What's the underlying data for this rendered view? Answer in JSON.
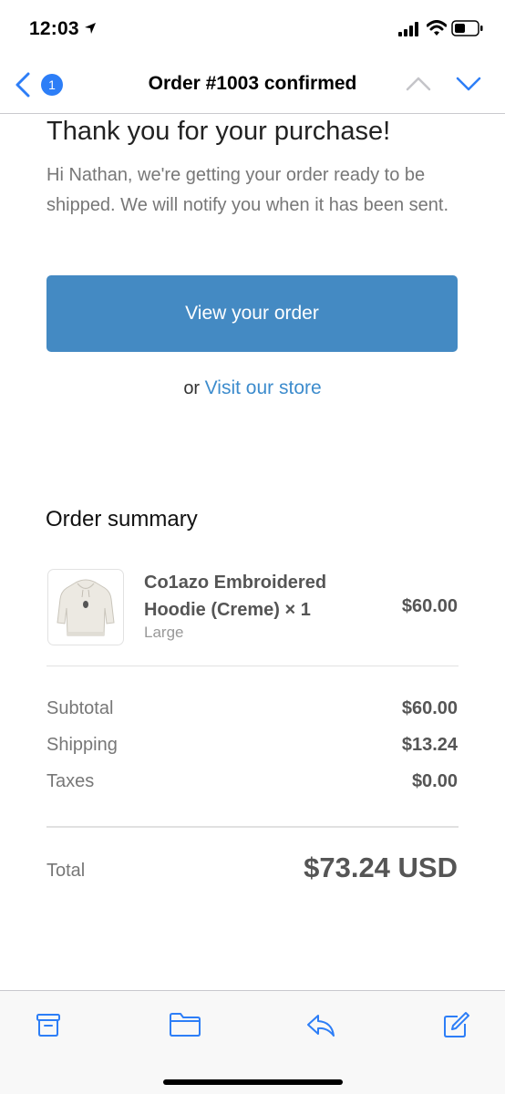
{
  "status_bar": {
    "time": "12:03",
    "icons": [
      "location-arrow-icon",
      "cellular-signal-icon",
      "wifi-icon",
      "battery-icon"
    ]
  },
  "nav": {
    "back_icon": "chevron-left-icon",
    "unread_count": "1",
    "title": "Order #1003 confirmed",
    "prev_icon": "chevron-up-icon",
    "next_icon": "chevron-down-icon"
  },
  "email": {
    "heading": "Thank you for your purchase!",
    "intro": "Hi Nathan, we're getting your order ready to be shipped. We will notify you when it has been sent.",
    "cta_label": "View your order",
    "alt_prefix": "or",
    "alt_link": "Visit our store",
    "summary_heading": "Order summary",
    "item": {
      "image": "hoodie-product-image",
      "name": "Co1azo Embroidered Hoodie (Creme) × 1",
      "variant": "Large",
      "price": "$60.00"
    },
    "lines": [
      {
        "label": "Subtotal",
        "value": "$60.00"
      },
      {
        "label": "Shipping",
        "value": "$13.24"
      },
      {
        "label": "Taxes",
        "value": "$0.00"
      }
    ],
    "total_label": "Total",
    "total_value": "$73.24 USD"
  },
  "toolbar": {
    "icons": [
      "archive-icon",
      "folder-icon",
      "reply-icon",
      "compose-icon"
    ]
  },
  "colors": {
    "accent": "#2d7ef7",
    "button": "#448ac3",
    "link": "#3d8ccd"
  }
}
